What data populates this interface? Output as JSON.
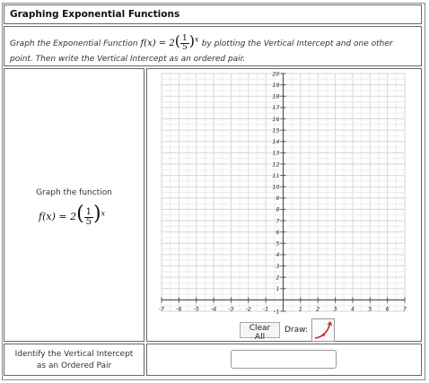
{
  "title": "Graphing Exponential Functions",
  "instruction": {
    "prefix": "Graph the Exponential Function",
    "func_name": "f(x)",
    "coef": "2",
    "numerator": "1",
    "denominator": "5",
    "exponent": "x",
    "suffix": "by plotting the Vertical Intercept and one other",
    "line2": "point. Then write the Vertical Intercept as an ordered pair."
  },
  "left_panel": {
    "label": "Graph the function"
  },
  "graph": {
    "x_min": -7,
    "x_max": 7,
    "y_min": -1,
    "y_max": 20,
    "grid": true,
    "x_ticks": [
      "-7",
      "-6",
      "-5",
      "-4",
      "-3",
      "-2",
      "-1",
      "1",
      "2",
      "3",
      "4",
      "5",
      "6",
      "7"
    ],
    "y_ticks": [
      "-1",
      "1",
      "2",
      "3",
      "4",
      "5",
      "6",
      "7",
      "8",
      "9",
      "10",
      "11",
      "12",
      "13",
      "14",
      "15",
      "16",
      "17",
      "18",
      "19",
      "20"
    ]
  },
  "toolbar": {
    "clear_label": "Clear All",
    "draw_label": "Draw:",
    "draw_tool_icon": "exponential-curve-icon"
  },
  "bottom": {
    "label_line1": "Identify the Vertical Intercept",
    "label_line2": "as an Ordered Pair",
    "answer_value": ""
  }
}
